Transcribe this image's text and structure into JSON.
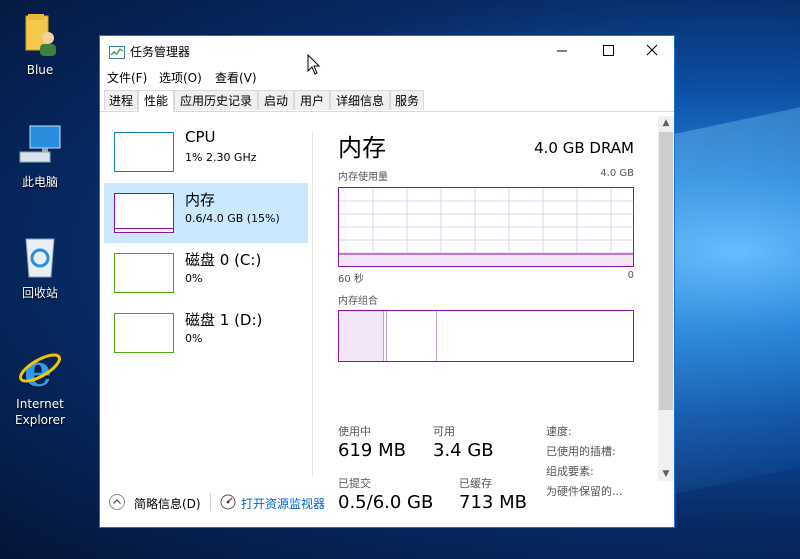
{
  "desktop": {
    "icons": [
      {
        "label": "Blue",
        "icon": "user-folder-icon"
      },
      {
        "label": "此电脑",
        "icon": "computer-icon"
      },
      {
        "label": "回收站",
        "icon": "recycle-bin-icon"
      },
      {
        "label": "Internet\nExplorer",
        "icon": "internet-explorer-icon"
      }
    ]
  },
  "window": {
    "title": "任务管理器",
    "menu": [
      "文件(F)",
      "选项(O)",
      "查看(V)"
    ],
    "tabs": [
      "进程",
      "性能",
      "应用历史记录",
      "启动",
      "用户",
      "详细信息",
      "服务"
    ],
    "active_tab": "性能"
  },
  "resources": [
    {
      "name": "CPU",
      "value": "1% 2.30 GHz",
      "color": "#117dbb"
    },
    {
      "name": "内存",
      "value": "0.6/4.0 GB (15%)",
      "color": "#8b12ae",
      "selected": true
    },
    {
      "name": "磁盘 0 (C:)",
      "value": "0%",
      "color": "#4da60c"
    },
    {
      "name": "磁盘 1 (D:)",
      "value": "0%",
      "color": "#4da60c"
    }
  ],
  "memory": {
    "title": "内存",
    "total_label": "4.0 GB DRAM",
    "usage_label": "内存使用量",
    "usage_max": "4.0 GB",
    "time_left": "60 秒",
    "time_right": "0",
    "composition_label": "内存组合",
    "in_use_fraction": 0.15,
    "in_use_label": "使用中",
    "in_use_value": "619 MB",
    "available_label": "可用",
    "available_value": "3.4 GB",
    "committed_label": "已提交",
    "committed_value": "0.5/6.0 GB",
    "cached_label": "已缓存",
    "cached_value": "713 MB",
    "speed_label": "速度:",
    "slots_label": "已使用的插槽:",
    "form_factor_label": "组成要素:",
    "reserved_label": "为硬件保留的..."
  },
  "footer": {
    "summary_label": "简略信息(D)",
    "resmon_label": "打开资源监视器"
  },
  "colors": {
    "memory": "#8b12ae",
    "cpu": "#117dbb",
    "disk": "#4da60c",
    "accent": "#0066cc"
  }
}
